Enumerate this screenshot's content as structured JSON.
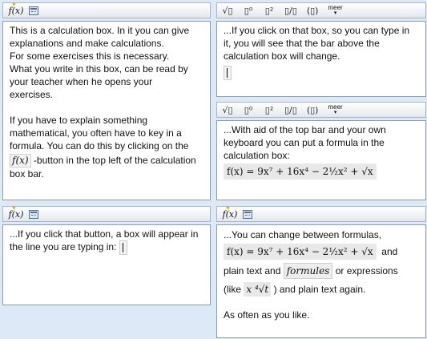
{
  "toolbar_basic": {
    "fx_label": "f(x)",
    "fx_icon": "fx-icon",
    "calc_icon": "calculator-icon"
  },
  "toolbar_math": {
    "sqrt": "√▯",
    "sub": "▯⁰",
    "pow": "▯²",
    "frac": "▯/▯",
    "paren": "(▯)",
    "more_label": "meer",
    "more_arrow": "▾"
  },
  "panel1": {
    "lines": [
      "This is a calculation box. In it you can give",
      "explanations and make calculations.",
      "For some exercises this is necessary.",
      "What you write in this box, can be read by",
      "your teacher when he opens your",
      "exercises."
    ],
    "lines2": [
      "If you have to explain something",
      "mathematical, you often have to key in a",
      "formula. You can do this by clicking on the"
    ],
    "fx_inline": "f(x)",
    "after_fx": "-button in the top left of the calculation",
    "last": "box bar."
  },
  "panel2": {
    "lines": [
      "...If you click on that box, so you can type in",
      "it, you will see that the bar above the",
      "calculation box will change."
    ]
  },
  "panel3": {
    "lines": [
      "...With aid of the top bar and your own",
      "keyboard you can put a formula in the",
      "calculation box:"
    ],
    "formula": "f(x) = 9x⁷ + 16x⁴ − 2½x² + √x"
  },
  "panel4": {
    "line1": "...If you click that button, a box will appear in",
    "line2": "the line you are typing in:"
  },
  "panel5": {
    "line1": "...You can change between formulas,",
    "formula": "f(x) = 9x⁷ + 16x⁴ − 2½x² + √x",
    "and": "and",
    "plain1": "plain text and",
    "formules": "formules",
    "or_expr": "or expressions",
    "like_open": "(like",
    "like_expr": "x ⁴√t",
    "like_close": ") and plain text again.",
    "last": "As often as you like."
  }
}
